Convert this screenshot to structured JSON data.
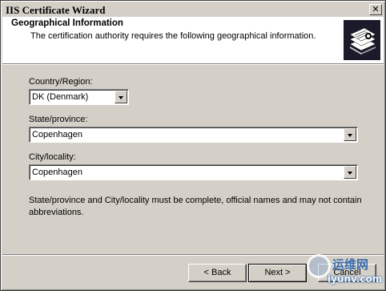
{
  "window": {
    "title": "IIS Certificate Wizard"
  },
  "header": {
    "title": "Geographical Information",
    "subtitle": "The certification authority requires the following geographical information.",
    "icon": "certificate-stack-icon"
  },
  "form": {
    "country_label": "Country/Region:",
    "country_value": "DK (Denmark)",
    "state_label": "State/province:",
    "state_value": "Copenhagen",
    "city_label": "City/locality:",
    "city_value": "Copenhagen",
    "note": "State/province and City/locality must be complete, official names and may not contain abbreviations."
  },
  "buttons": {
    "back": "< Back",
    "next": "Next >",
    "cancel": "Cancel"
  },
  "watermark": {
    "text1": "运维网",
    "text2": "iyunv.com"
  }
}
